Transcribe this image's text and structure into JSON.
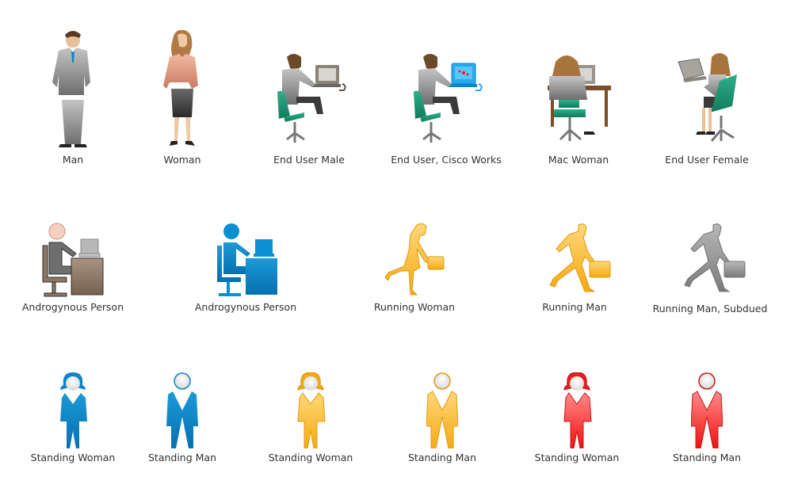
{
  "palette": {
    "blue": "#0a86c8",
    "orange": "#f7b21c",
    "red": "#ee2226",
    "gray": "#8a8a8a",
    "chair": "#1f9a78",
    "suit": "#8f8f8f"
  },
  "rows": [
    {
      "items": [
        {
          "label": "Man",
          "icon": "man-icon"
        },
        {
          "label": "Woman",
          "icon": "woman-icon"
        },
        {
          "label": "End User Male",
          "icon": "end-user-male-icon"
        },
        {
          "label": "End User, Cisco Works",
          "icon": "end-user-cisco-works-icon"
        },
        {
          "label": "Mac Woman",
          "icon": "mac-woman-icon"
        },
        {
          "label": "End User Female",
          "icon": "end-user-female-icon"
        }
      ]
    },
    {
      "items": [
        {
          "label": "Androgynous Person",
          "icon": "androgynous-person-brown-icon"
        },
        {
          "label": "Androgynous Person",
          "icon": "androgynous-person-blue-icon"
        },
        {
          "label": "Running Woman",
          "icon": "running-woman-icon"
        },
        {
          "label": "Running Man",
          "icon": "running-man-icon"
        },
        {
          "label": "Running Man, Subdued",
          "icon": "running-man-subdued-icon"
        }
      ]
    },
    {
      "items": [
        {
          "label": "Standing Woman",
          "icon": "standing-woman-blue-icon"
        },
        {
          "label": "Standing Man",
          "icon": "standing-man-blue-icon"
        },
        {
          "label": "Standing Woman",
          "icon": "standing-woman-orange-icon"
        },
        {
          "label": "Standing Man",
          "icon": "standing-man-orange-icon"
        },
        {
          "label": "Standing Woman",
          "icon": "standing-woman-red-icon"
        },
        {
          "label": "Standing Man",
          "icon": "standing-man-red-icon"
        }
      ]
    }
  ]
}
